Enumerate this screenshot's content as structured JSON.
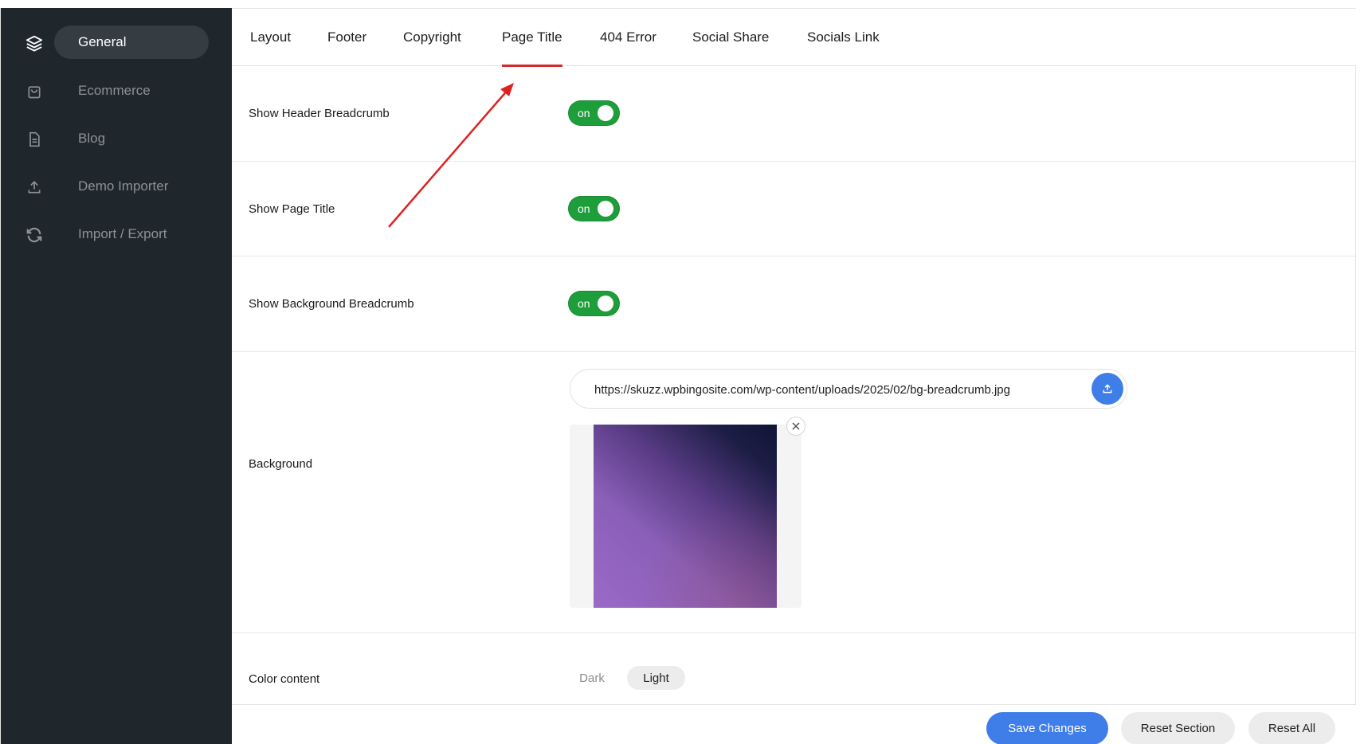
{
  "sidebar": {
    "items": [
      {
        "label": "General",
        "icon": "layers-icon",
        "active": true
      },
      {
        "label": "Ecommerce",
        "icon": "shopping-bag-icon"
      },
      {
        "label": "Blog",
        "icon": "document-icon"
      },
      {
        "label": "Demo Importer",
        "icon": "upload-icon"
      },
      {
        "label": "Import / Export",
        "icon": "sync-icon"
      }
    ]
  },
  "tabs": [
    {
      "label": "Layout"
    },
    {
      "label": "Footer"
    },
    {
      "label": "Copyright"
    },
    {
      "label": "Page Title",
      "active": true
    },
    {
      "label": "404 Error"
    },
    {
      "label": "Social Share"
    },
    {
      "label": "Socials Link"
    }
  ],
  "settings": {
    "show_header_breadcrumb": {
      "label": "Show Header Breadcrumb",
      "state": "on"
    },
    "show_page_title": {
      "label": "Show Page Title",
      "state": "on"
    },
    "show_background_breadcrumb": {
      "label": "Show Background Breadcrumb",
      "state": "on"
    },
    "background": {
      "label": "Background",
      "url": "https://skuzz.wpbingosite.com/wp-content/uploads/2025/02/bg-breadcrumb.jpg"
    },
    "color_content": {
      "label": "Color content",
      "options": [
        "Dark",
        "Light"
      ],
      "selected": "Light"
    }
  },
  "footer": {
    "save_label": "Save Changes",
    "reset_section_label": "Reset Section",
    "reset_all_label": "Reset All"
  },
  "colors": {
    "sidebar_bg": "#1f262c",
    "accent_blue": "#3f7ee8",
    "toggle_on": "#1d9e3a",
    "tab_underline": "#d12d2d"
  }
}
